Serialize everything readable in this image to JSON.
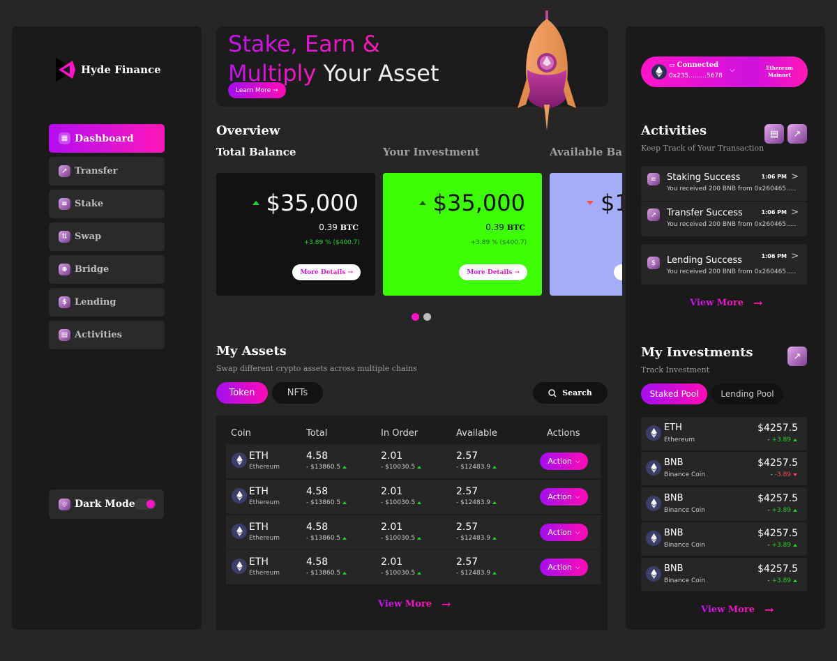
{
  "brand": {
    "name": "Hyde Finance"
  },
  "sidebar": {
    "items": [
      {
        "label": "Dashboard",
        "icon": "dashboard-icon"
      },
      {
        "label": "Transfer",
        "icon": "arrow-up-right-icon"
      },
      {
        "label": "Stake",
        "icon": "stack-icon"
      },
      {
        "label": "Swap",
        "icon": "swap-icon"
      },
      {
        "label": "Bridge",
        "icon": "bridge-icon"
      },
      {
        "label": "Lending",
        "icon": "lending-icon"
      },
      {
        "label": "Activities",
        "icon": "calendar-icon"
      }
    ],
    "dark_mode_label": "Dark Mode",
    "dark_mode_on": true
  },
  "hero": {
    "line1": "Stake, Earn &",
    "line2_accent": "Multiply",
    "line2_rest": " Your Asset",
    "learn_more": "Learn More →"
  },
  "overview": {
    "title": "Overview",
    "card_titles": [
      "Total Balance",
      "Your Investment",
      "Available Bal"
    ],
    "cards": [
      {
        "amount": "$35,000",
        "btc_value": "0.39",
        "btc_unit": "BTC",
        "change": "+3.89 % ($400.7)",
        "trend": "up",
        "bg": "#121212",
        "more": "More Details →"
      },
      {
        "amount": "$35,000",
        "btc_value": "0.39",
        "btc_unit": "BTC",
        "change": "+3.89 % ($400.7)",
        "trend": "up",
        "bg": "#3dff06",
        "more": "More Details →"
      },
      {
        "amount": "$1",
        "trend": "down",
        "bg": "#a3adf9"
      }
    ],
    "pagination": {
      "active": 0,
      "count": 2
    }
  },
  "assets": {
    "title": "My Assets",
    "subtitle": "Swap different crypto assets across multiple chains",
    "tabs": [
      "Token",
      "NFTs"
    ],
    "active_tab": "Token",
    "search_label": "Search",
    "columns": [
      "Coin",
      "Total",
      "In Order",
      "Available",
      "Actions"
    ],
    "rows": [
      {
        "coin": "ETH",
        "chain": "Ethereum",
        "total": "4.58",
        "total_usd": "- $13860.5",
        "in_order": "2.01",
        "in_order_usd": "- $10030.5",
        "available": "2.57",
        "available_usd": "- $12483.9",
        "action": "Action"
      },
      {
        "coin": "ETH",
        "chain": "Ethereum",
        "total": "4.58",
        "total_usd": "- $13860.5",
        "in_order": "2.01",
        "in_order_usd": "- $10030.5",
        "available": "2.57",
        "available_usd": "- $12483.9",
        "action": "Action"
      },
      {
        "coin": "ETH",
        "chain": "Ethereum",
        "total": "4.58",
        "total_usd": "- $13860.5",
        "in_order": "2.01",
        "in_order_usd": "- $10030.5",
        "available": "2.57",
        "available_usd": "- $12483.9",
        "action": "Action"
      },
      {
        "coin": "ETH",
        "chain": "Ethereum",
        "total": "4.58",
        "total_usd": "- $13860.5",
        "in_order": "2.01",
        "in_order_usd": "- $10030.5",
        "available": "2.57",
        "available_usd": "- $12483.9",
        "action": "Action"
      }
    ],
    "view_more": "View More"
  },
  "wallet": {
    "status": "Connected",
    "address": "0x235.........5678",
    "network": "Ethereum Mainnet"
  },
  "activities": {
    "title": "Activities",
    "subtitle": "Keep Track of Your Transaction",
    "items": [
      {
        "title": "Staking Success",
        "time": "1:06 PM",
        "desc": "You received 200 BNB from 0x260465.....",
        "icon": "stack-icon"
      },
      {
        "title": "Transfer Success",
        "time": "1:06 PM",
        "desc": "You received 200 BNB from 0x260465.....",
        "icon": "arrow-up-right-icon"
      },
      {
        "title": "Lending Success",
        "time": "1:06 PM",
        "desc": "You received 200 BNB from 0x260465.....",
        "icon": "lending-icon"
      }
    ],
    "view_more": "View More"
  },
  "investments": {
    "title": "My Investments",
    "subtitle": "Track Investment",
    "tabs": [
      "Staked Pool",
      "Lending Pool"
    ],
    "active_tab": "Staked Pool",
    "items": [
      {
        "symbol": "ETH",
        "name": "Ethereum",
        "price": "$4257.5",
        "change": "- +3.89",
        "trend": "up"
      },
      {
        "symbol": "BNB",
        "name": "Binance Coin",
        "price": "$4257.5",
        "change": "- -3.89",
        "trend": "down"
      },
      {
        "symbol": "BNB",
        "name": "Binance Coin",
        "price": "$4257.5",
        "change": "- +3.89",
        "trend": "up"
      },
      {
        "symbol": "BNB",
        "name": "Binance Coin",
        "price": "$4257.5",
        "change": "- +3.89",
        "trend": "up"
      },
      {
        "symbol": "BNB",
        "name": "Binance Coin",
        "price": "$4257.5",
        "change": "- +3.89",
        "trend": "up"
      }
    ],
    "view_more": "View More"
  },
  "colors": {
    "accent_start": "#a20ff0",
    "accent_end": "#ff0bb4",
    "up": "#25d326",
    "down": "#ff4a4a"
  }
}
